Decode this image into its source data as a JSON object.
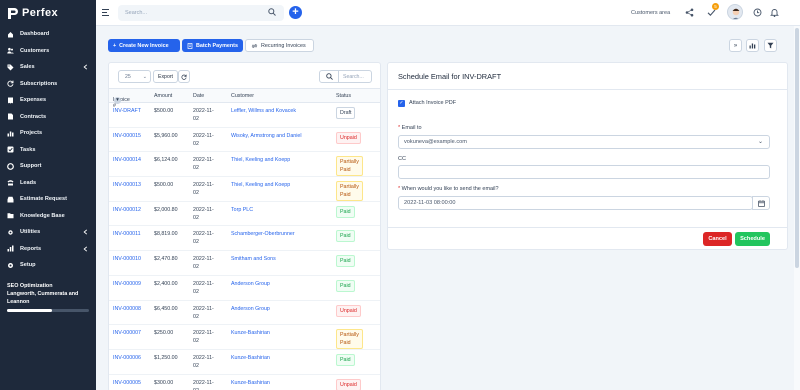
{
  "app": {
    "name": "Perfex"
  },
  "sidebar": {
    "items": [
      {
        "label": "Dashboard",
        "icon": "home-icon",
        "has_submenu": false
      },
      {
        "label": "Customers",
        "icon": "users-icon",
        "has_submenu": false
      },
      {
        "label": "Sales",
        "icon": "tag-icon",
        "has_submenu": true
      },
      {
        "label": "Subscriptions",
        "icon": "refresh-icon",
        "has_submenu": false
      },
      {
        "label": "Expenses",
        "icon": "receipt-icon",
        "has_submenu": false
      },
      {
        "label": "Contracts",
        "icon": "document-icon",
        "has_submenu": false
      },
      {
        "label": "Projects",
        "icon": "chart-icon",
        "has_submenu": false
      },
      {
        "label": "Tasks",
        "icon": "check-icon",
        "has_submenu": false
      },
      {
        "label": "Support",
        "icon": "lifebuoy-icon",
        "has_submenu": false
      },
      {
        "label": "Leads",
        "icon": "tty-icon",
        "has_submenu": false
      },
      {
        "label": "Estimate Request",
        "icon": "inbox-icon",
        "has_submenu": false
      },
      {
        "label": "Knowledge Base",
        "icon": "folder-icon",
        "has_submenu": false
      },
      {
        "label": "Utilities",
        "icon": "cog-icon",
        "has_submenu": true
      },
      {
        "label": "Reports",
        "icon": "bar-chart-icon",
        "has_submenu": true
      },
      {
        "label": "Setup",
        "icon": "gear-icon",
        "has_submenu": false
      }
    ],
    "project": {
      "title": "SEO Optimization",
      "client": "Langworth, Cummerata and Leannon",
      "progress": 0.55
    }
  },
  "header": {
    "search_placeholder": "Search...",
    "customers_area": "Customers area",
    "notification_count": "5"
  },
  "toolbar": {
    "create_invoice": "Create New Invoice",
    "batch_payments": "Batch Payments",
    "recurring_invoices": "Recurring Invoices"
  },
  "table": {
    "per_page": "25",
    "export": "Export",
    "search_placeholder": "Search...",
    "columns": [
      "Invoice #",
      "Amount",
      "Date",
      "Customer",
      "Status"
    ],
    "rows": [
      {
        "number": "INV-DRAFT",
        "amount": "$500.00",
        "date": "2022-11-02",
        "customer": "Leffler, Willms and Kovacek",
        "status": "Draft",
        "status_type": "draft"
      },
      {
        "number": "INV-000015",
        "amount": "$5,960.00",
        "date": "2022-11-02",
        "customer": "Wisoky, Armstrong and Daniel",
        "status": "Unpaid",
        "status_type": "unpaid"
      },
      {
        "number": "INV-000014",
        "amount": "$6,124.00",
        "date": "2022-11-02",
        "customer": "Thiel, Keeling and Koepp",
        "status": "Partially Paid",
        "status_type": "partial"
      },
      {
        "number": "INV-000013",
        "amount": "$500.00",
        "date": "2022-11-02",
        "customer": "Thiel, Keeling and Koepp",
        "status": "Partially Paid",
        "status_type": "partial"
      },
      {
        "number": "INV-000012",
        "amount": "$2,000.80",
        "date": "2022-11-02",
        "customer": "Torp PLC",
        "status": "Paid",
        "status_type": "paid"
      },
      {
        "number": "INV-000011",
        "amount": "$8,819.00",
        "date": "2022-11-02",
        "customer": "Schamberger-Oberbrunner",
        "status": "Paid",
        "status_type": "paid"
      },
      {
        "number": "INV-000010",
        "amount": "$2,470.80",
        "date": "2022-11-02",
        "customer": "Smitham and Sons",
        "status": "Paid",
        "status_type": "paid"
      },
      {
        "number": "INV-000009",
        "amount": "$2,400.00",
        "date": "2022-11-02",
        "customer": "Anderson Group",
        "status": "Paid",
        "status_type": "paid"
      },
      {
        "number": "INV-000008",
        "amount": "$6,450.00",
        "date": "2022-11-02",
        "customer": "Anderson Group",
        "status": "Unpaid",
        "status_type": "unpaid"
      },
      {
        "number": "INV-000007",
        "amount": "$250.00",
        "date": "2022-11-02",
        "customer": "Kunze-Bashirian",
        "status": "Partially Paid",
        "status_type": "partial"
      },
      {
        "number": "INV-000006",
        "amount": "$1,250.00",
        "date": "2022-11-02",
        "customer": "Kunze-Bashirian",
        "status": "Paid",
        "status_type": "paid"
      },
      {
        "number": "INV-000005",
        "amount": "$300.00",
        "date": "2022-11-02",
        "customer": "Kunze-Bashirian",
        "status": "Unpaid",
        "status_type": "unpaid"
      }
    ]
  },
  "schedule": {
    "title": "Schedule Email for INV-DRAFT",
    "attach_label": "Attach Invoice PDF",
    "attach_checked": true,
    "email_label": "Email to",
    "email_value": "vokuneva@example.com",
    "cc_label": "CC",
    "cc_value": "",
    "when_label": "When would you like to send the email?",
    "when_value": "2022-11-03 08:00:00",
    "cancel": "Cancel",
    "schedule": "Schedule"
  },
  "colors": {
    "primary": "#2563eb",
    "sidebar": "#1e293b",
    "danger": "#dc2626",
    "success": "#22c55e"
  }
}
